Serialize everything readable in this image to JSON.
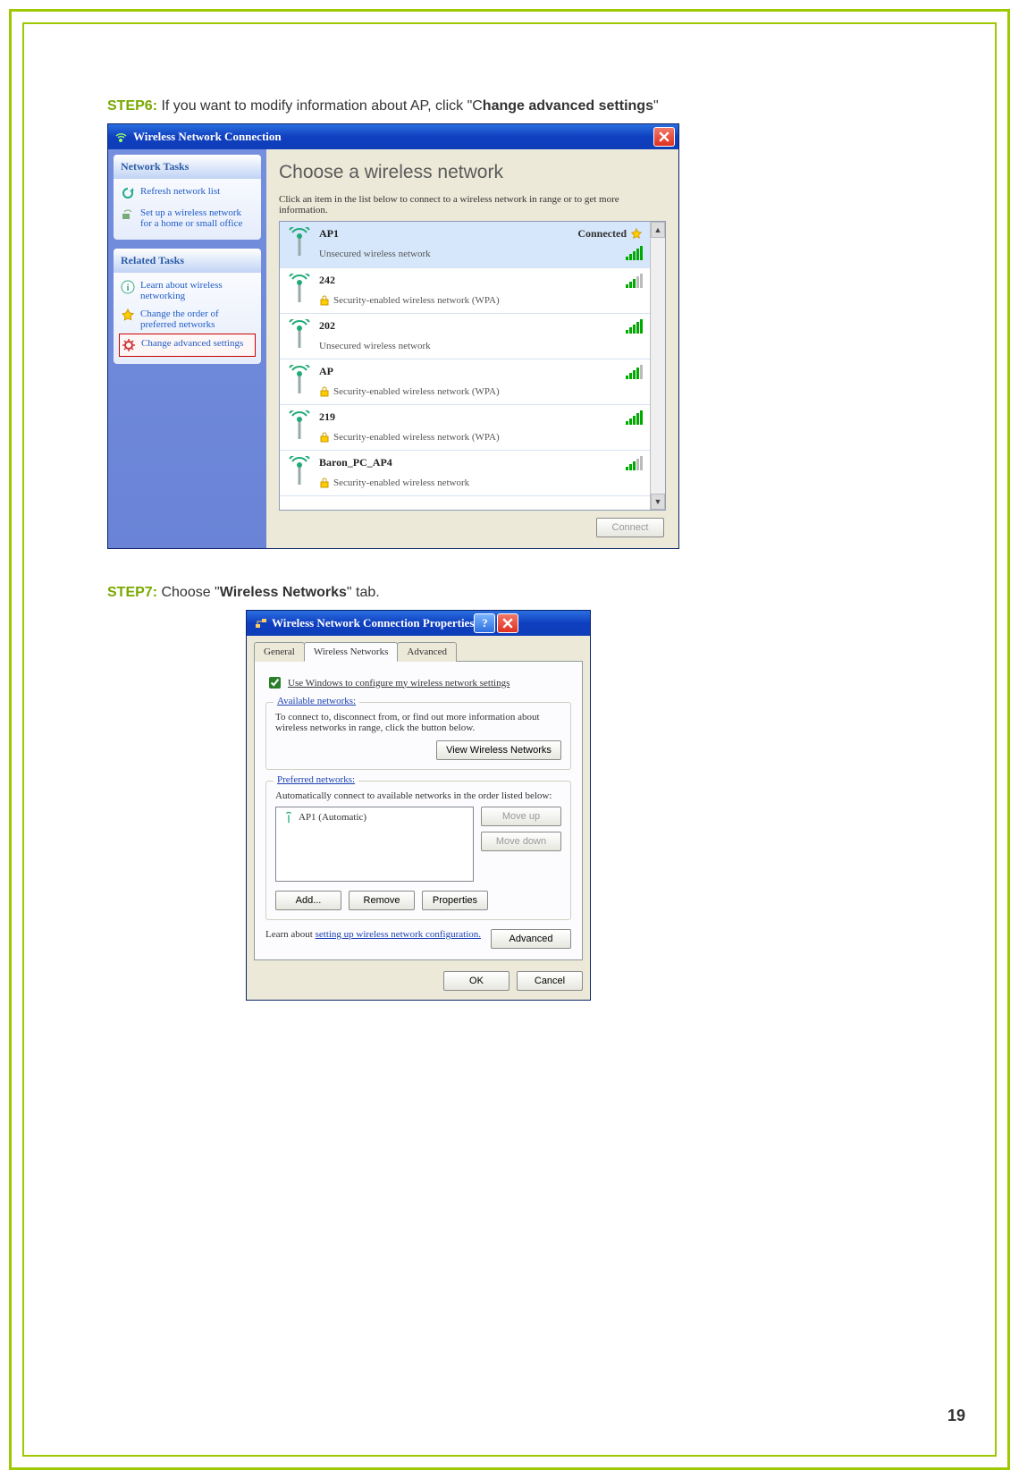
{
  "page_number": "19",
  "step6": {
    "label": "STEP6:",
    "text_pre": " If you want to modify information about AP, click \"C",
    "text_bold": "hange advanced settings",
    "text_post": "\""
  },
  "step7": {
    "label": "STEP7:",
    "text_pre": " Choose \"",
    "text_bold": "Wireless Networks",
    "text_post": "\" tab."
  },
  "win1": {
    "title": "Wireless Network Connection",
    "side": {
      "network_tasks_title": "Network Tasks",
      "refresh": "Refresh network list",
      "setup": "Set up a wireless network for a home or small office",
      "related_title": "Related Tasks",
      "learn": "Learn about wireless networking",
      "order": "Change the order of preferred networks",
      "advanced": "Change advanced settings"
    },
    "main": {
      "heading": "Choose a wireless network",
      "sub": "Click an item in the list below to connect to a wireless network in range or to get more information.",
      "connect_btn": "Connect"
    },
    "nets": [
      {
        "name": "AP1",
        "sub": "Unsecured wireless network",
        "status": "Connected",
        "signal": 5,
        "locked": false,
        "selected": true
      },
      {
        "name": "242",
        "sub": "Security-enabled wireless network (WPA)",
        "signal": 3,
        "locked": true
      },
      {
        "name": "202",
        "sub": "Unsecured wireless network",
        "signal": 5,
        "locked": false
      },
      {
        "name": "AP",
        "sub": "Security-enabled wireless network (WPA)",
        "signal": 4,
        "locked": true
      },
      {
        "name": "219",
        "sub": "Security-enabled wireless network (WPA)",
        "signal": 5,
        "locked": true
      },
      {
        "name": "Baron_PC_AP4",
        "sub": "Security-enabled wireless network",
        "signal": 3,
        "locked": true
      }
    ]
  },
  "win2": {
    "title": "Wireless Network Connection Properties",
    "tabs": {
      "general": "General",
      "wireless": "Wireless Networks",
      "advanced": "Advanced"
    },
    "cfg_label": "Use Windows to configure my wireless network settings",
    "avail": {
      "title": "Available networks:",
      "text": "To connect to, disconnect from, or find out more information about wireless networks in range, click the button below.",
      "btn": "View Wireless Networks"
    },
    "pref": {
      "title": "Preferred networks:",
      "text": "Automatically connect to available networks in the order listed below:",
      "item": "AP1 (Automatic)",
      "moveup": "Move up",
      "movedown": "Move down",
      "add": "Add...",
      "remove": "Remove",
      "props": "Properties"
    },
    "learn_text_pre": "Learn about ",
    "learn_link": "setting up wireless network configuration.",
    "adv_btn": "Advanced",
    "ok": "OK",
    "cancel": "Cancel"
  }
}
